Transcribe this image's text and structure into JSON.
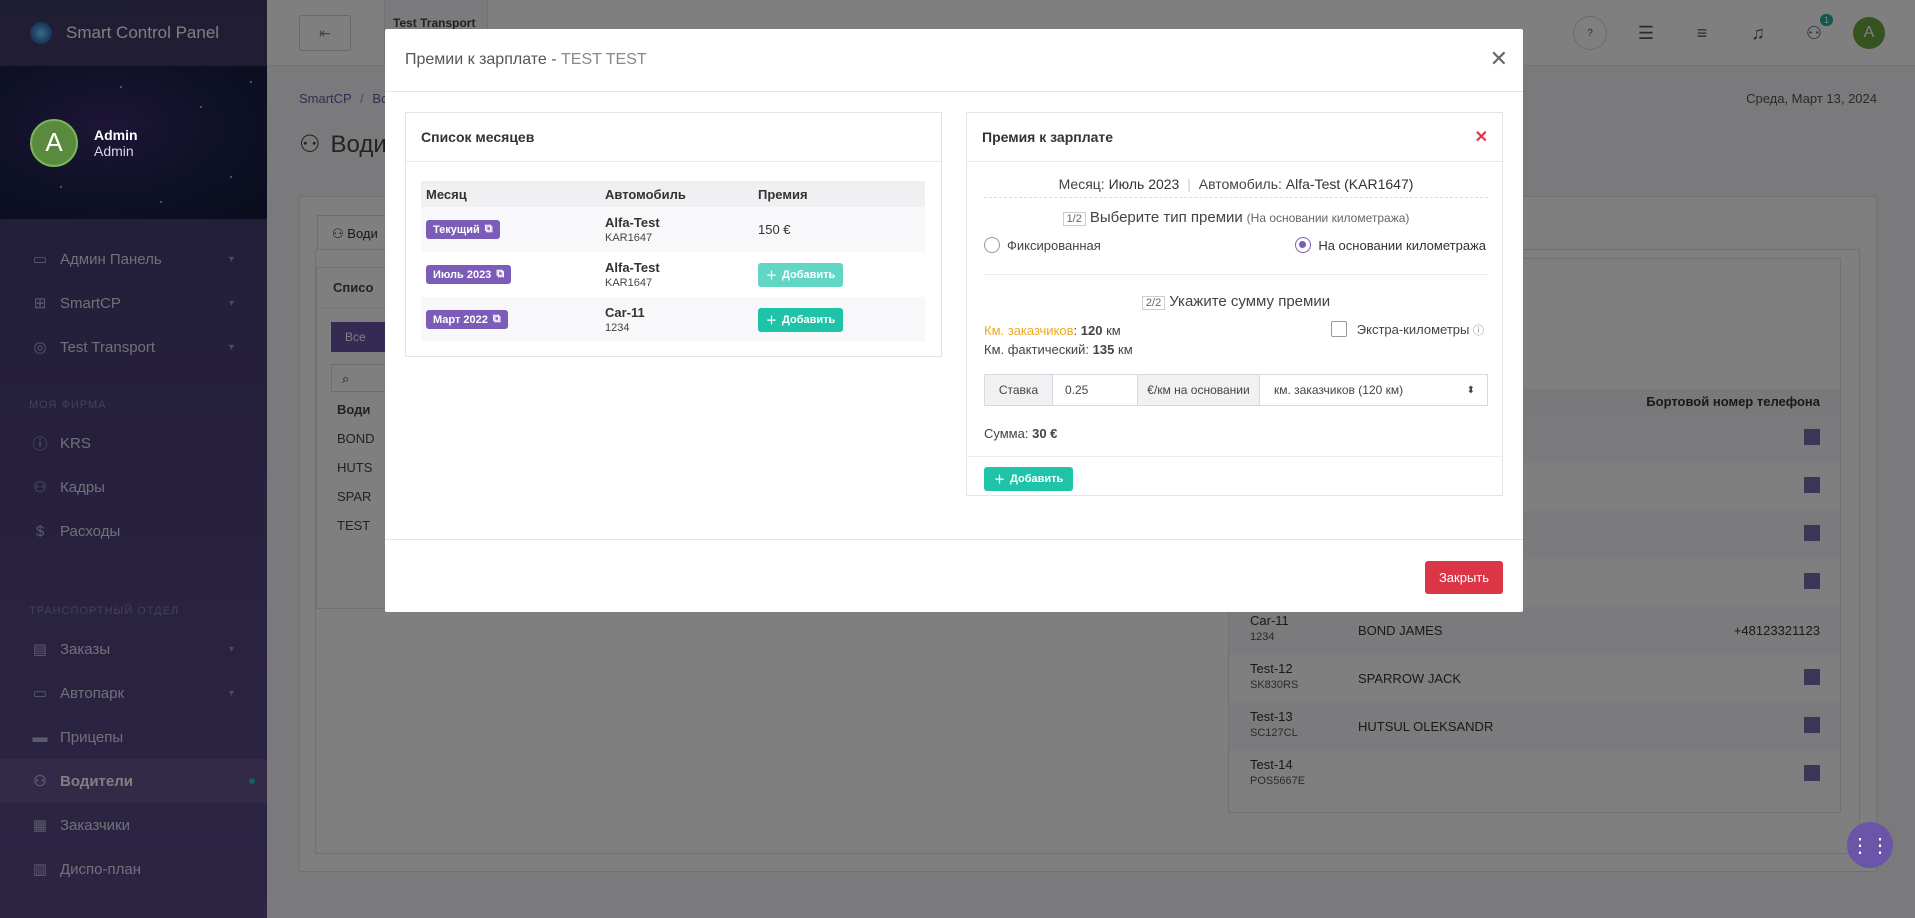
{
  "app": {
    "title": "Smart Control Panel"
  },
  "user": {
    "name": "Admin",
    "role": "Admin",
    "initial": "A"
  },
  "sidebar": {
    "items_top": [
      {
        "label": "Админ Панель",
        "icon": "dashboard-icon"
      },
      {
        "label": "SmartCP",
        "icon": "smartcp-icon"
      },
      {
        "label": "Test Transport",
        "icon": "transport-icon"
      }
    ],
    "section1": "МОЯ ФИРМА",
    "items_firm": [
      {
        "label": "KRS",
        "icon": "info-icon"
      },
      {
        "label": "Кадры",
        "icon": "people-icon"
      },
      {
        "label": "Расходы",
        "icon": "expenses-icon"
      }
    ],
    "section2": "ТРАНСПОРТНЫЙ ОТДЕЛ",
    "items_transport": [
      {
        "label": "Заказы",
        "icon": "orders-icon"
      },
      {
        "label": "Автопарк",
        "icon": "truck-icon"
      },
      {
        "label": "Прицепы",
        "icon": "trailer-icon"
      },
      {
        "label": "Водители",
        "icon": "drivers-icon"
      },
      {
        "label": "Заказчики",
        "icon": "clients-icon"
      },
      {
        "label": "Диспо-план",
        "icon": "plan-icon"
      }
    ]
  },
  "topbar": {
    "back_glyph": "⇤",
    "tab_label": "Test Transport",
    "notifications_badge": "1",
    "avatar_initial": "A"
  },
  "page": {
    "breadcrumb_root": "SmartCP",
    "breadcrumb_sep": "/",
    "breadcrumb_next": "Во",
    "date": "Среда, Март 13, 2024",
    "title": "Води",
    "inner_tab": "Води",
    "list_title": "Списо",
    "all_btn": "Все",
    "left_rows": [
      "Води",
      "BOND",
      "HUTS",
      "SPAR",
      "TEST"
    ]
  },
  "bg_table": {
    "phone_header": "Бортовой номер телефона",
    "rows": [
      {
        "car": "Car-11",
        "plate": "1234",
        "driver": "BOND JAMES",
        "phone": "+48123321123"
      },
      {
        "car": "Test-12",
        "plate": "SK830RS",
        "driver": "SPARROW JACK",
        "phone": ""
      },
      {
        "car": "Test-13",
        "plate": "SC127CL",
        "driver": "HUTSUL OLEKSANDR",
        "phone": ""
      },
      {
        "car": "Test-14",
        "plate": "POS5667E",
        "driver": "",
        "phone": ""
      }
    ]
  },
  "modal": {
    "title": "Премии к зарплате - ",
    "title_name": "TEST TEST",
    "close_label": "Закрыть",
    "months_card": {
      "title": "Список месяцев",
      "headers": [
        "Месяц",
        "Автомобиль",
        "Премия"
      ],
      "rows": [
        {
          "month": "Текущий",
          "car": "Alfa-Test",
          "plate": "KAR1647",
          "premium": "150 €"
        },
        {
          "month": "Июль 2023",
          "car": "Alfa-Test",
          "plate": "KAR1647",
          "premium": ""
        },
        {
          "month": "Март 2022",
          "car": "Car-11",
          "plate": "1234",
          "premium": ""
        }
      ],
      "add_label": "Добавить"
    },
    "premium_card": {
      "title": "Премия к зарплате",
      "month_label": "Месяц:",
      "month_value": "Июль 2023",
      "car_label": "Автомобиль:",
      "car_value": "Alfa-Test (KAR1647)",
      "step1": "1/2",
      "step1_text": "Выберите тип премии",
      "step1_hint": "(На основании километража)",
      "opt_fixed": "Фиксированная",
      "opt_km": "На основании километража",
      "step2": "2/2",
      "step2_text": "Укажите сумму премии",
      "km_client_label": "Км. заказчиков",
      "km_client_value": "120",
      "km_unit": "км",
      "km_actual_label": "Км. фактический:",
      "km_actual_value": "135",
      "extra_km_label": "Экстра-километры",
      "rate_label": "Ставка",
      "rate_value": "0.25",
      "rate_unit": "€/км на основании",
      "rate_basis": "км. заказчиков (120 км)",
      "sum_label": "Сумма:",
      "sum_value": "30 €",
      "add_label": "Добавить"
    }
  },
  "colors": {
    "accent": "#7b5cb8",
    "teal": "#1fc4a8",
    "danger": "#dc3545",
    "km_client": "#f0a81f"
  }
}
